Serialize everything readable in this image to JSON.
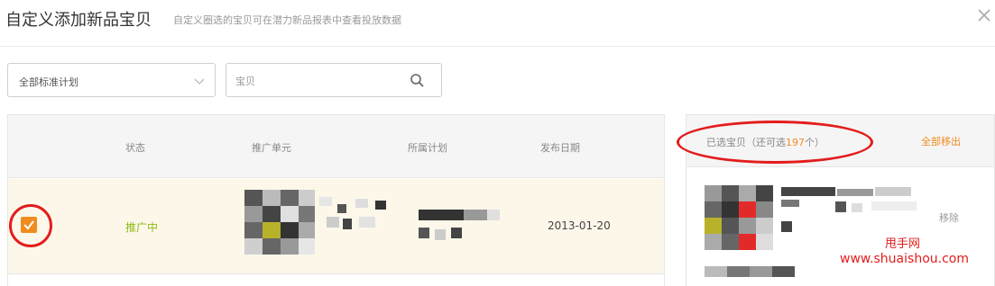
{
  "dialog": {
    "title": "自定义添加新品宝贝",
    "subtitle": "自定义圈选的宝贝可在潜力新品报表中查看投放数据"
  },
  "filters": {
    "plan_select_value": "全部标准计划",
    "search_placeholder": "宝贝"
  },
  "table": {
    "columns": [
      "状态",
      "推广单元",
      "所属计划",
      "发布日期"
    ],
    "rows": [
      {
        "checked": true,
        "status": "推广中",
        "date": "2013-01-20"
      }
    ]
  },
  "selected_panel": {
    "label_prefix": "已选宝贝（还可选",
    "remaining": "197",
    "label_suffix": "个）",
    "remove_all_label": "全部移出",
    "remove_label": "移除"
  },
  "watermark": {
    "line1": "甩手网",
    "line2": "www.shuaishou.com"
  },
  "colors": {
    "accent": "#f08c1e",
    "status_active": "#8dbb12",
    "annotation": "#e31c1c"
  },
  "icons": {
    "close": "close-icon",
    "search": "search-icon",
    "dropdown": "chevron-down-icon",
    "checkbox": "check-icon"
  }
}
